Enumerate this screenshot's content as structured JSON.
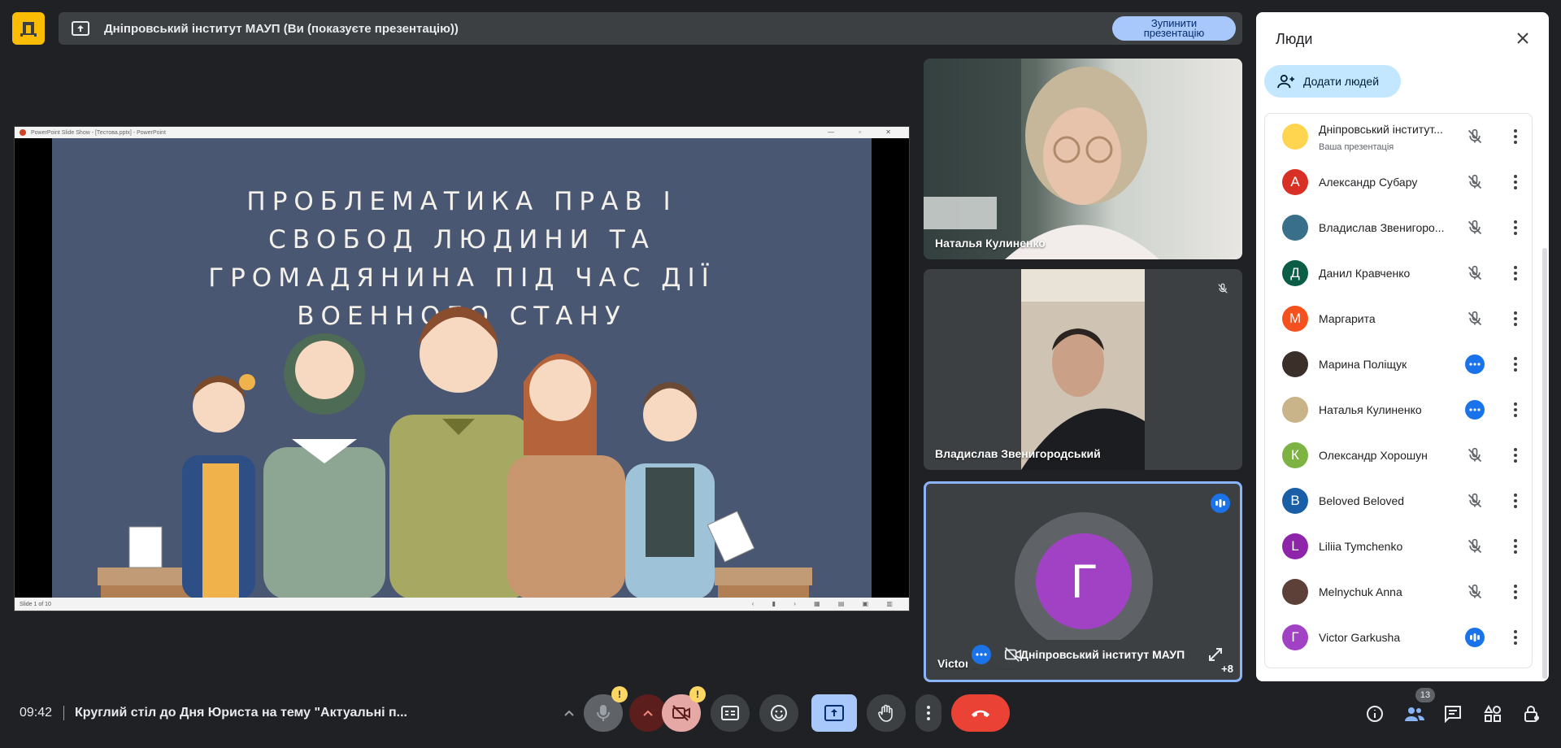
{
  "window": {
    "presenting_text": "Дніпровський інститут МАУП (Ви (показуєте презентацію))",
    "stop_button": "Зупинити презентацію"
  },
  "slide": {
    "app_titlebar": "PowerPoint Slide Show - [Тестова.pptx] - PowerPoint",
    "title_lines": [
      "ПРОБЛЕМАТИКА ПРАВ І",
      "СВОБОД ЛЮДИНИ ТА",
      "ГРОМАДЯНИНА ПІД ЧАС ДІЇ",
      "ВОЕННОГО СТАНУ"
    ],
    "status": "Slide 1 of 10",
    "bg_color": "#4a5772"
  },
  "tiles": [
    {
      "name": "Наталья Кулиненко"
    },
    {
      "name": "Владислав Звенигородський",
      "muted": true
    },
    {
      "name": "Victor Garkusha",
      "avatar_letter": "Г",
      "avatar_color": "#a142c4",
      "overlay_text": "Дніпровський інститут МАУП",
      "extra_count": "+8"
    }
  ],
  "people_panel": {
    "title": "Люди",
    "add_button": "Додати людей",
    "participants": [
      {
        "name": "Дніпровський інститут...",
        "sub": "Ваша презентація",
        "letter": "",
        "color": "#ffd54f",
        "mic": "muted"
      },
      {
        "name": "Александр Субару",
        "letter": "А",
        "color": "#d93025",
        "mic": "muted"
      },
      {
        "name": "Владислав Звенигоро...",
        "letter": "",
        "color": "#3a6f8a",
        "mic": "muted"
      },
      {
        "name": "Данил Кравченко",
        "letter": "Д",
        "color": "#0b5d46",
        "mic": "muted"
      },
      {
        "name": "Маргарита",
        "letter": "М",
        "color": "#f4511e",
        "mic": "muted"
      },
      {
        "name": "Марина Поліщук",
        "letter": "",
        "color": "#3b2f2a",
        "mic": "active"
      },
      {
        "name": "Наталья Кулиненко",
        "letter": "",
        "color": "#c9b489",
        "mic": "active"
      },
      {
        "name": "Олександр Хорошун",
        "letter": "К",
        "color": "#7cb342",
        "mic": "muted"
      },
      {
        "name": "Beloved Beloved",
        "letter": "B",
        "color": "#1a5ea8",
        "mic": "muted"
      },
      {
        "name": "Liliia Tymchenko",
        "letter": "L",
        "color": "#8e24aa",
        "mic": "muted"
      },
      {
        "name": "Melnychuk Anna",
        "letter": "",
        "color": "#5d4037",
        "mic": "muted"
      },
      {
        "name": "Victor Garkusha",
        "letter": "Г",
        "color": "#a142c4",
        "mic": "speaking"
      }
    ]
  },
  "bottom": {
    "time": "09:42",
    "meeting_title": "Круглий стіл до Дня Юриста на тему \"Актуальні п...",
    "people_count": "13",
    "warn_mark": "!"
  }
}
